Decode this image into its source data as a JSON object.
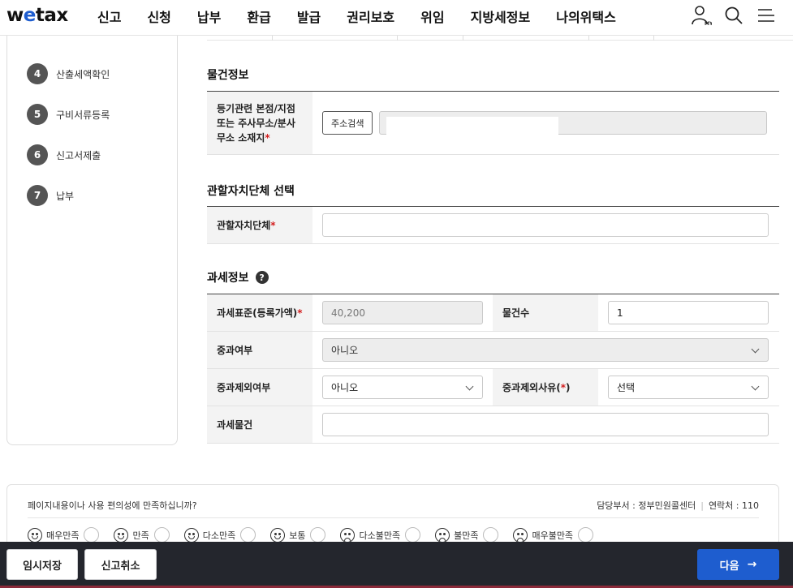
{
  "header": {
    "logo_w": "w",
    "logo_e": "e",
    "logo_rest": "tax",
    "nav": [
      "신고",
      "신청",
      "납부",
      "환급",
      "발급",
      "권리보호",
      "위임",
      "지방세정보",
      "나의위택스"
    ],
    "icons": [
      "my-user-icon",
      "search-icon",
      "menu-icon"
    ],
    "my_label": "MY"
  },
  "steps": [
    {
      "num": "4",
      "label": "산출세액확인"
    },
    {
      "num": "5",
      "label": "구비서류등록"
    },
    {
      "num": "6",
      "label": "신고서제출"
    },
    {
      "num": "7",
      "label": "납부"
    }
  ],
  "property": {
    "title": "물건정보",
    "addr_label_1": "등기관련 본점/지점",
    "addr_label_2": "또는 주사무소/분사",
    "addr_label_3": "무소 소재지",
    "req": "*",
    "addr_button": "주소검색",
    "addr_value": ""
  },
  "jurisdiction": {
    "title": "관할자치단체 선택",
    "label": "관할자치단체",
    "req": "*",
    "value": ""
  },
  "taxation": {
    "title": "과세정보",
    "help": "?",
    "tax_base_label": "과세표준(등록가액)",
    "tax_base_req": "*",
    "tax_base_value": "40,200",
    "count_label": "물건수",
    "count_value": "1",
    "heavy_label": "중과여부",
    "heavy_value": "아니오",
    "heavy_excl_label": "중과제외여부",
    "heavy_excl_value": "아니오",
    "heavy_reason_label": "중과제외사유",
    "heavy_reason_open": "(",
    "heavy_reason_star": "*",
    "heavy_reason_close": ")",
    "heavy_reason_value": "선택",
    "object_label": "과세물건",
    "object_value": ""
  },
  "feedback": {
    "question": "페이지내용이나 사용 편의성에 만족하십니까?",
    "dept": "담당부서 : 정부민원콜센터",
    "contact": "연락처 : 110",
    "options": [
      {
        "label": "매우만족",
        "face": "happy"
      },
      {
        "label": "만족",
        "face": "happy"
      },
      {
        "label": "다소만족",
        "face": "happy"
      },
      {
        "label": "보통",
        "face": "happy"
      },
      {
        "label": "다소불만족",
        "face": "sad"
      },
      {
        "label": "불만족",
        "face": "sad"
      },
      {
        "label": "매우불만족",
        "face": "sad"
      }
    ]
  },
  "bottom": {
    "save": "임시저장",
    "cancel": "신고취소",
    "next": "다음",
    "next_arrow": "→"
  },
  "colors": {
    "brand": "#1e5dcf",
    "required": "#d31f1f",
    "bottom_bar": "#24262d"
  }
}
